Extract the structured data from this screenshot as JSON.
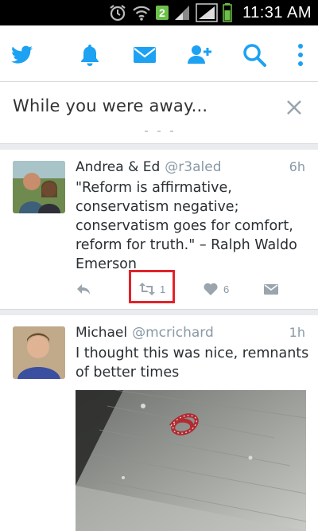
{
  "status_bar": {
    "badge": "2",
    "time": "11:31 AM"
  },
  "nav": {
    "items": [
      {
        "name": "home",
        "icon": "twitter-bird-icon"
      },
      {
        "name": "notifications",
        "icon": "bell-icon"
      },
      {
        "name": "messages",
        "icon": "envelope-icon"
      },
      {
        "name": "add-user",
        "icon": "add-user-icon"
      },
      {
        "name": "search",
        "icon": "search-icon"
      },
      {
        "name": "more",
        "icon": "more-vert-icon"
      }
    ],
    "accent": "#1da1f2"
  },
  "away_card": {
    "title": "While you were away..."
  },
  "tweets": [
    {
      "name": "Andrea & Ed",
      "handle": "@r3aled",
      "time": "6h",
      "text": "\"Reform is affirmative, conservatism negative; conservatism goes for comfort, reform for truth.\" – Ralph Waldo Emerson",
      "retweets": "1",
      "likes": "6"
    },
    {
      "name": "Michael",
      "handle": "@mcrichard",
      "time": "1h",
      "text": "I thought this was nice, remnants of better times"
    }
  ],
  "colors": {
    "highlight": "#e2232a",
    "muted": "#8899a6"
  }
}
